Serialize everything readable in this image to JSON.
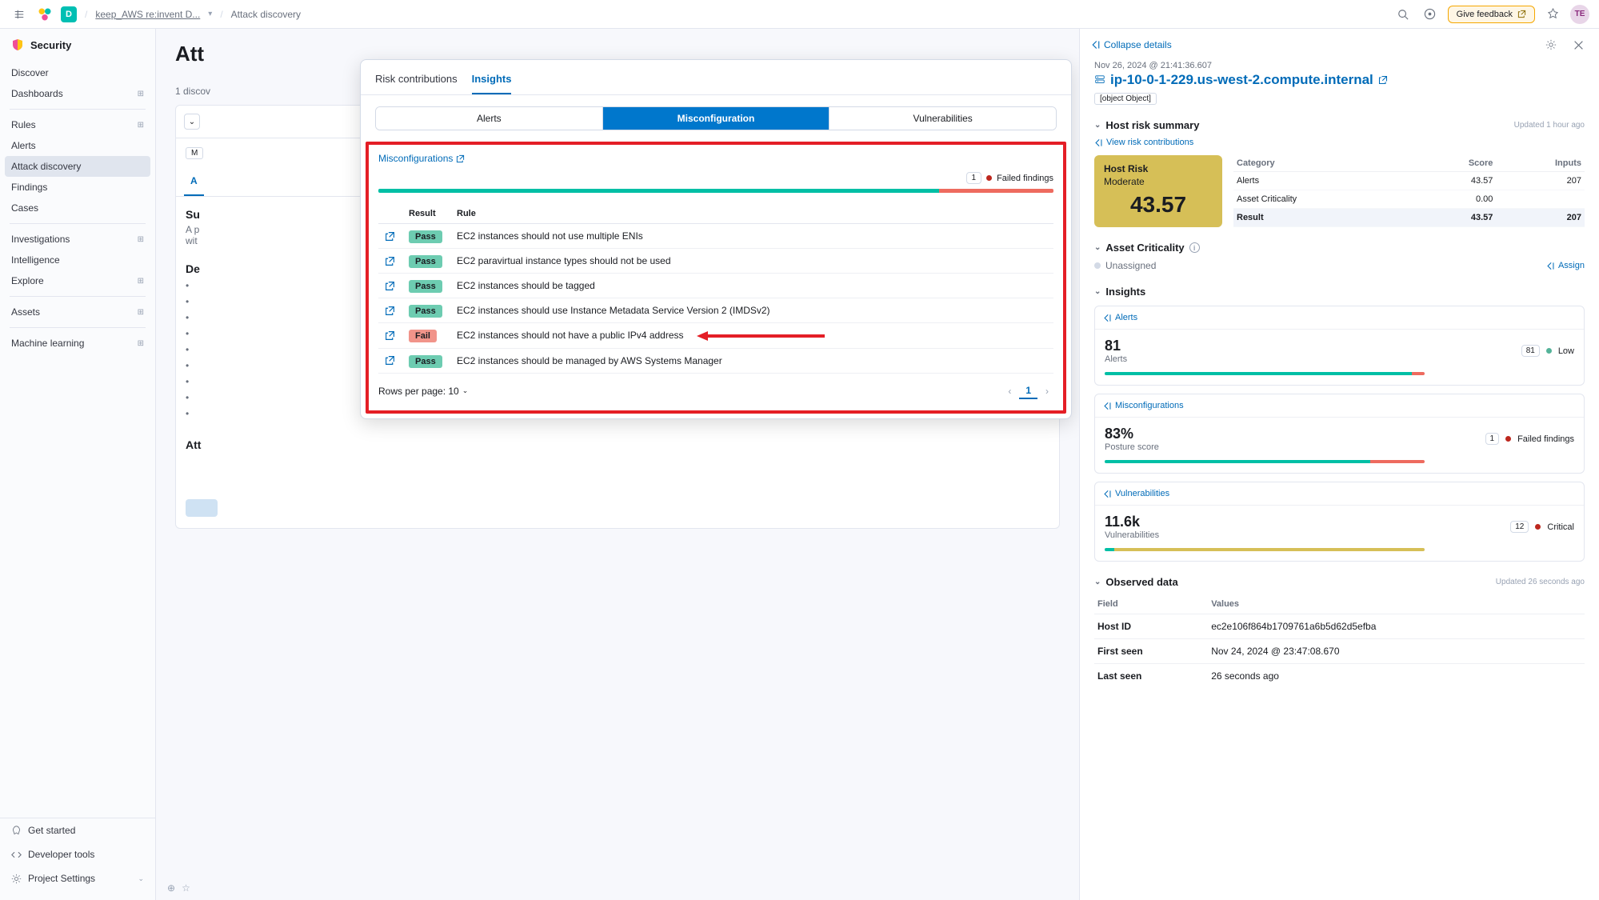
{
  "topbar": {
    "space_letter": "D",
    "breadcrumb1": "keep_AWS re:invent D...",
    "breadcrumb2": "Attack discovery",
    "feedback": "Give feedback",
    "avatar": "TE"
  },
  "sidebar": {
    "title": "Security",
    "groups": [
      {
        "items": [
          {
            "label": "Discover"
          },
          {
            "label": "Dashboards",
            "grid": true
          }
        ]
      },
      {
        "items": [
          {
            "label": "Rules",
            "grid": true
          },
          {
            "label": "Alerts"
          },
          {
            "label": "Attack discovery",
            "active": true
          },
          {
            "label": "Findings"
          },
          {
            "label": "Cases"
          }
        ]
      },
      {
        "items": [
          {
            "label": "Investigations",
            "grid": true
          },
          {
            "label": "Intelligence"
          },
          {
            "label": "Explore",
            "grid": true
          }
        ]
      },
      {
        "items": [
          {
            "label": "Assets",
            "grid": true
          }
        ]
      },
      {
        "items": [
          {
            "label": "Machine learning",
            "grid": true
          }
        ]
      }
    ],
    "footer": [
      {
        "label": "Get started",
        "icon": "rocket"
      },
      {
        "label": "Developer tools",
        "icon": "code"
      },
      {
        "label": "Project Settings",
        "icon": "gear",
        "chev": true
      }
    ]
  },
  "bg": {
    "heading": "Att",
    "discoveries": "1 discov",
    "tab_badge": "M",
    "tab_active": "A",
    "card_heading": "Su",
    "card_sub1": "A p",
    "card_sub2": "wit",
    "details": "De",
    "chain": "Att"
  },
  "popover": {
    "top_tabs": [
      "Risk contributions",
      "Insights"
    ],
    "tri_tabs": [
      "Alerts",
      "Misconfiguration",
      "Vulnerabilities"
    ],
    "misconf_link": "Misconfigurations",
    "failed_count": "1",
    "failed_label": "Failed findings",
    "columns": [
      "",
      "Result",
      "Rule"
    ],
    "rows": [
      {
        "result": "Pass",
        "rule": "EC2 instances should not use multiple ENIs"
      },
      {
        "result": "Pass",
        "rule": "EC2 paravirtual instance types should not be used"
      },
      {
        "result": "Pass",
        "rule": "EC2 instances should be tagged"
      },
      {
        "result": "Pass",
        "rule": "EC2 instances should use Instance Metadata Service Version 2 (IMDSv2)"
      },
      {
        "result": "Fail",
        "rule": "EC2 instances should not have a public IPv4 address",
        "arrow": true
      },
      {
        "result": "Pass",
        "rule": "EC2 instances should be managed by AWS Systems Manager"
      }
    ],
    "rows_per_page": "Rows per page: 10",
    "page": "1"
  },
  "flyout": {
    "collapse": "Collapse details",
    "timestamp": "Nov 26, 2024 @ 21:41:36.607",
    "host_name": "ip-10-0-1-229.us-west-2.compute.internal",
    "observed": {
      "title": "Observed data",
      "updated": "Updated 26 seconds ago",
      "head": [
        "Field",
        "Values"
      ],
      "rows": [
        {
          "f": "Host ID",
          "v": "ec2e106f864b1709761a6b5d62d5efba"
        },
        {
          "f": "First seen",
          "v": "Nov 24, 2024 @ 23:47:08.670"
        },
        {
          "f": "Last seen",
          "v": "26 seconds ago"
        }
      ]
    },
    "risk_summary": {
      "title": "Host risk summary",
      "updated": "Updated 1 hour ago",
      "view_link": "View risk contributions",
      "box_title": "Host Risk",
      "box_sev": "Moderate",
      "box_score": "43.57",
      "table_head": [
        "Category",
        "Score",
        "Inputs"
      ],
      "table_rows": [
        {
          "cat": "Alerts",
          "score": "43.57",
          "inputs": "207"
        },
        {
          "cat": "Asset Criticality",
          "score": "0.00",
          "inputs": ""
        },
        {
          "cat": "Result",
          "score": "43.57",
          "inputs": "207",
          "hl": true
        }
      ]
    },
    "asset_crit": {
      "title": "Asset Criticality",
      "value": "Unassigned",
      "assign": "Assign"
    },
    "insights": {
      "title": "Insights",
      "cards": [
        {
          "link": "Alerts",
          "num": "81",
          "label": "Alerts",
          "pill": "81",
          "sev": "Low",
          "sev_class": "sev-low",
          "bar_green": 96,
          "bar_red": 4
        },
        {
          "link": "Misconfigurations",
          "num": "83%",
          "label": "Posture score",
          "pill": "1",
          "sev": "Failed findings",
          "sev_class": "dot-red",
          "bar_green": 83,
          "bar_red": 17
        },
        {
          "link": "Vulnerabilities",
          "num": "11.6k",
          "label": "Vulnerabilities",
          "pill": "12",
          "sev": "Critical",
          "sev_class": "sev-crit",
          "bar_green": 3,
          "bar_yellow": 97
        }
      ]
    }
  }
}
